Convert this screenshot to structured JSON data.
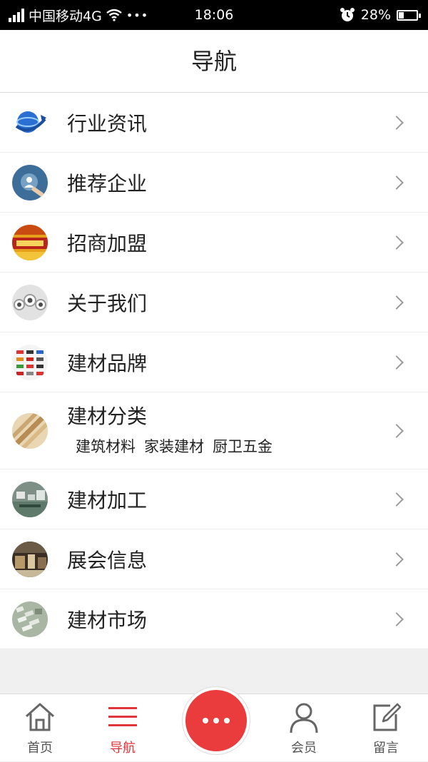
{
  "status_bar": {
    "carrier": "中国移动4G",
    "dots": "•••",
    "time": "18:06",
    "battery_text": "28%",
    "battery_level": 0.28
  },
  "header": {
    "title": "导航"
  },
  "menu": {
    "items": [
      {
        "label": "行业资讯",
        "icon": "globe-news-icon"
      },
      {
        "label": "推荐企业",
        "icon": "business-network-icon"
      },
      {
        "label": "招商加盟",
        "icon": "investment-banner-icon"
      },
      {
        "label": "关于我们",
        "icon": "pipes-icon"
      },
      {
        "label": "建材品牌",
        "icon": "brand-logos-icon"
      },
      {
        "label": "建材分类",
        "icon": "wood-planks-icon",
        "tags": [
          "建筑材料",
          "家装建材",
          "厨卫五金"
        ]
      },
      {
        "label": "建材加工",
        "icon": "factory-icon"
      },
      {
        "label": "展会信息",
        "icon": "exhibition-hall-icon"
      },
      {
        "label": "建材市场",
        "icon": "market-aerial-icon"
      }
    ]
  },
  "tabbar": {
    "home": "首页",
    "nav": "导航",
    "member": "会员",
    "message": "留言"
  },
  "colors": {
    "accent": "#e0353b",
    "fab": "#ea3c3c"
  }
}
